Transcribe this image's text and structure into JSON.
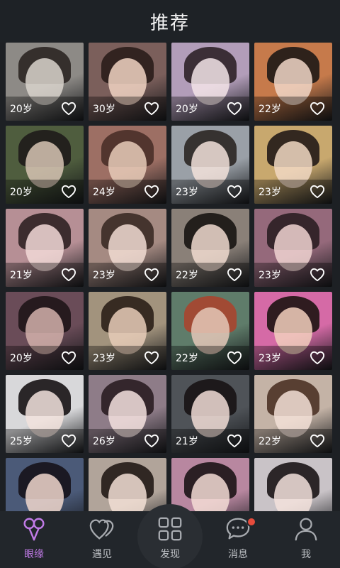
{
  "header": {
    "title": "推荐"
  },
  "accent_color": "#c07ae6",
  "cards": [
    {
      "age": "20岁",
      "bg": "#8d8a86",
      "skin": "#d9d3cd",
      "hair": "#2b2522"
    },
    {
      "age": "30岁",
      "bg": "#7b5f5b",
      "skin": "#f1d3c3",
      "hair": "#2a1d1a"
    },
    {
      "age": "20岁",
      "bg": "#b29db9",
      "skin": "#f3e4e8",
      "hair": "#2d2228"
    },
    {
      "age": "22岁",
      "bg": "#c67a4b",
      "skin": "#f0d6c7",
      "hair": "#1d1816"
    },
    {
      "age": "20岁",
      "bg": "#4f5d3e",
      "skin": "#d7c4b4",
      "hair": "#1e1b1a"
    },
    {
      "age": "24岁",
      "bg": "#9d6f64",
      "skin": "#e8cbb9",
      "hair": "#4a2f28"
    },
    {
      "age": "23岁",
      "bg": "#9aa0a7",
      "skin": "#f2e2da",
      "hair": "#2b2624"
    },
    {
      "age": "23岁",
      "bg": "#c8a86e",
      "skin": "#f1d8c3",
      "hair": "#221a17"
    },
    {
      "age": "21岁",
      "bg": "#b68f95",
      "skin": "#f2d9d7",
      "hair": "#2f2122"
    },
    {
      "age": "23岁",
      "bg": "#a58a82",
      "skin": "#f1dcd2",
      "hair": "#3b2a25"
    },
    {
      "age": "22岁",
      "bg": "#8a8078",
      "skin": "#f0dbcf",
      "hair": "#171412"
    },
    {
      "age": "23岁",
      "bg": "#95697b",
      "skin": "#f0d3d1",
      "hair": "#2a1e22"
    },
    {
      "age": "20岁",
      "bg": "#6a4c58",
      "skin": "#d3b2ac",
      "hair": "#1f1518"
    },
    {
      "age": "23岁",
      "bg": "#a2937d",
      "skin": "#e8cdb8",
      "hair": "#2b2018"
    },
    {
      "age": "22岁",
      "bg": "#5f7c6a",
      "skin": "#e4c8b8",
      "hair": "#a8452f"
    },
    {
      "age": "23岁",
      "bg": "#d56aa6",
      "skin": "#f2cfbd",
      "hair": "#1d1412"
    },
    {
      "age": "25岁",
      "bg": "#d8d8da",
      "skin": "#f2e3dd",
      "hair": "#171314"
    },
    {
      "age": "26岁",
      "bg": "#8e7c88",
      "skin": "#f4e2df",
      "hair": "#2a1d22"
    },
    {
      "age": "21岁",
      "bg": "#4f5358",
      "skin": "#f1ddd6",
      "hair": "#171315"
    },
    {
      "age": "22岁",
      "bg": "#c4b3a6",
      "skin": "#f3e1d7",
      "hair": "#4d3226"
    },
    {
      "age": "",
      "bg": "#4b5a78",
      "skin": "#f0d7cc",
      "hair": "#16121a"
    },
    {
      "age": "",
      "bg": "#b1a49a",
      "skin": "#f2dfd5",
      "hair": "#221a16"
    },
    {
      "age": "",
      "bg": "#b887a0",
      "skin": "#f3dcd5",
      "hair": "#1c1416"
    },
    {
      "age": "",
      "bg": "#c9c3c7",
      "skin": "#f3e2dc",
      "hair": "#1b1516"
    }
  ],
  "tabs": [
    {
      "label": "眼缘",
      "icon": "balloons-icon",
      "active": true
    },
    {
      "label": "遇见",
      "icon": "hearts-icon",
      "active": false
    },
    {
      "label": "发现",
      "icon": "grid-icon",
      "active": false
    },
    {
      "label": "消息",
      "icon": "chat-icon",
      "active": false,
      "badge": true
    },
    {
      "label": "我",
      "icon": "person-icon",
      "active": false
    }
  ]
}
